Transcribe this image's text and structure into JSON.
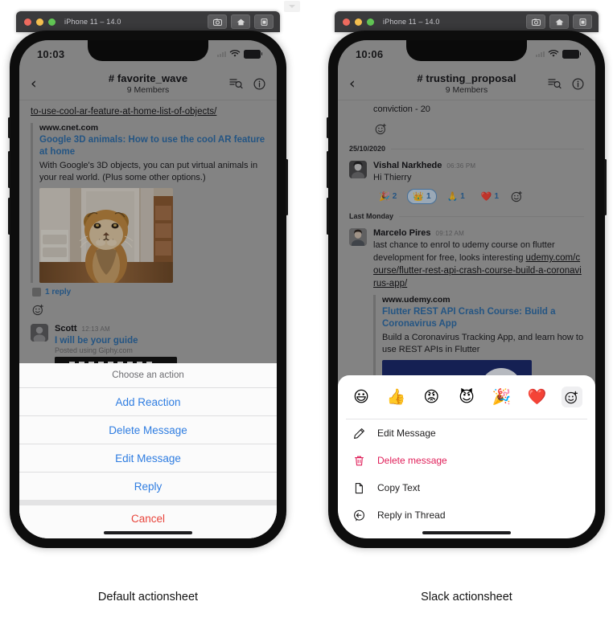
{
  "captions": {
    "left": "Default actionsheet",
    "right": "Slack actionsheet"
  },
  "simulator": {
    "title": "iPhone 11 – 14.0",
    "buttons": [
      "camera-icon",
      "home-icon",
      "rotate-icon"
    ]
  },
  "phone_left": {
    "status": {
      "time": "10:03",
      "wifi": "wifi-icon",
      "battery": "battery-icon"
    },
    "nav": {
      "back": "‹",
      "title": "# favorite_wave",
      "subtitle": "9 Members",
      "action_icons": [
        "threads-icon",
        "info-icon"
      ]
    },
    "messages": {
      "top_link": "to-use-cool-ar-feature-at-home-list-of-objects/",
      "attachment": {
        "site": "www.cnet.com",
        "title": "Google 3D animals: How to use the cool AR feature at home",
        "description": "With Google's 3D objects, you can put virtual animals in your real world. (Plus some other options.)",
        "image": "tiger-ar-photo"
      },
      "reply_count": "1 reply",
      "add_reaction": "add-reaction-icon",
      "scott": {
        "name": "Scott",
        "time": "12:13 AM",
        "giphy_title": "I will be your guide",
        "giphy_sub": "Posted using Giphy.com",
        "giphy_image": "things-i-can-tell-gif"
      }
    },
    "actionsheet": {
      "header": "Choose an action",
      "items": [
        "Add Reaction",
        "Delete Message",
        "Edit Message",
        "Reply"
      ],
      "cancel": "Cancel"
    }
  },
  "phone_right": {
    "status": {
      "time": "10:06",
      "wifi": "wifi-icon",
      "battery": "battery-icon"
    },
    "nav": {
      "back": "‹",
      "title": "# trusting_proposal",
      "subtitle": "9 Members",
      "action_icons": [
        "threads-icon",
        "info-icon"
      ]
    },
    "messages": {
      "partial_text": "conviction - 20",
      "add_reaction": "add-reaction-icon",
      "date_divider_1": "25/10/2020",
      "vishal": {
        "name": "Vishal Narkhede",
        "time": "06:36 PM",
        "text": "Hi Thierry",
        "reactions": [
          {
            "emoji": "🎉",
            "count": "2",
            "selected": false
          },
          {
            "emoji": "👑",
            "count": "1",
            "selected": true
          },
          {
            "emoji": "🙏",
            "count": "1",
            "selected": false
          },
          {
            "emoji": "❤️",
            "count": "1",
            "selected": false
          }
        ],
        "add_reaction": "add-reaction-icon"
      },
      "date_divider_2": "Last Monday",
      "marcelo": {
        "name": "Marcelo Pires",
        "time": "09:12 AM",
        "text_before": "last chance to enrol to udemy course on flutter development for free, looks interesting ",
        "link": "udemy.com/course/flutter-rest-api-crash-course-build-a-coronavirus-app/",
        "attachment": {
          "site": "www.udemy.com",
          "title": "Flutter REST API Crash Course: Build a Coronavirus App",
          "description": "Build a Coronavirus Tracking App, and learn how to use REST APIs in Flutter",
          "image": "udemy-course-thumbnail"
        }
      }
    },
    "actionsheet": {
      "emojis": [
        "😃",
        "👍",
        "😡",
        "😈",
        "🎉",
        "❤️"
      ],
      "add_reaction": "add-reaction-icon",
      "items": [
        {
          "icon": "pencil-icon",
          "label": "Edit Message",
          "danger": false
        },
        {
          "icon": "trash-icon",
          "label": "Delete message",
          "danger": true
        },
        {
          "icon": "document-icon",
          "label": "Copy Text",
          "danger": false
        },
        {
          "icon": "thread-icon",
          "label": "Reply in Thread",
          "danger": false
        }
      ]
    }
  },
  "colors": {
    "ios_blue": "#2f7de1",
    "ios_red": "#e8453c",
    "slack_red": "#e0205a",
    "slack_link": "#2f6da8"
  }
}
